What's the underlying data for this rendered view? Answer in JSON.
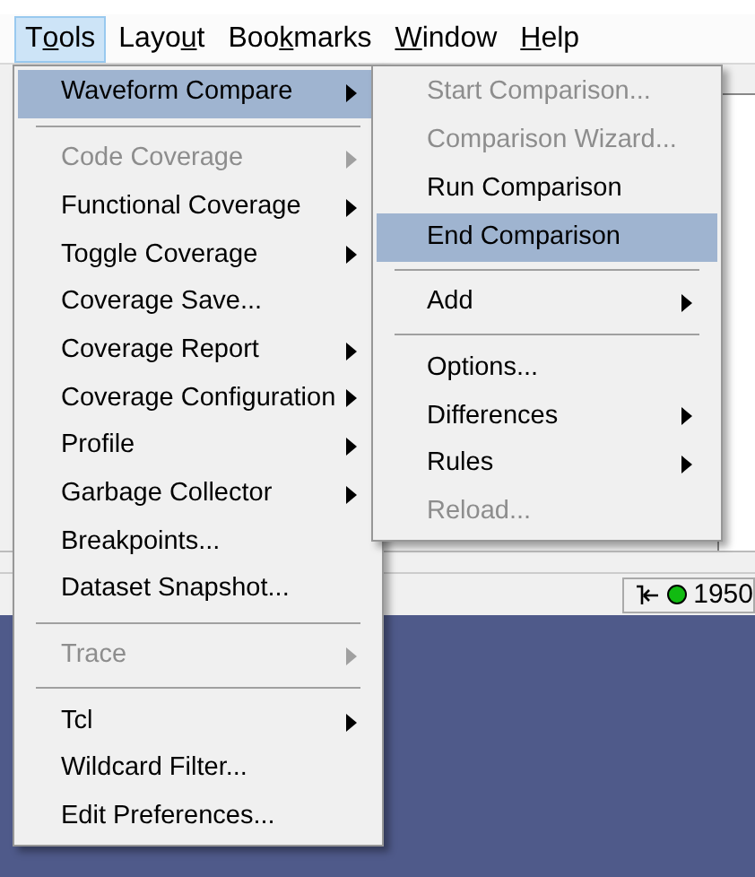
{
  "menu_bar": [
    {
      "before": "T",
      "mnemonic": "o",
      "after": "ols",
      "selected": true
    },
    {
      "before": "Layo",
      "mnemonic": "u",
      "after": "t",
      "selected": false
    },
    {
      "before": "Boo",
      "mnemonic": "k",
      "after": "marks",
      "selected": false
    },
    {
      "mnemonic": "W",
      "after": "indow",
      "selected": false
    },
    {
      "mnemonic": "H",
      "after": "elp",
      "selected": false
    }
  ],
  "tools_menu": [
    {
      "kind": "item",
      "label": "Waveform Compare",
      "submenu": true,
      "selected": true,
      "disabled": false
    },
    {
      "kind": "separator"
    },
    {
      "kind": "item",
      "label": "Code Coverage",
      "submenu": true,
      "selected": false,
      "disabled": true
    },
    {
      "kind": "item",
      "label": "Functional Coverage",
      "submenu": true,
      "selected": false,
      "disabled": false
    },
    {
      "kind": "item",
      "label": "Toggle Coverage",
      "submenu": true,
      "selected": false,
      "disabled": false
    },
    {
      "kind": "item",
      "label": "Coverage Save...",
      "submenu": false,
      "selected": false,
      "disabled": false
    },
    {
      "kind": "item",
      "label": "Coverage Report",
      "submenu": true,
      "selected": false,
      "disabled": false
    },
    {
      "kind": "item",
      "label": "Coverage Configuration",
      "submenu": true,
      "selected": false,
      "disabled": false
    },
    {
      "kind": "item",
      "label": "Profile",
      "submenu": true,
      "selected": false,
      "disabled": false
    },
    {
      "kind": "item",
      "label": "Garbage Collector",
      "submenu": true,
      "selected": false,
      "disabled": false
    },
    {
      "kind": "item",
      "label": "Breakpoints...",
      "submenu": false,
      "selected": false,
      "disabled": false
    },
    {
      "kind": "item",
      "label": "Dataset Snapshot...",
      "submenu": false,
      "selected": false,
      "disabled": false
    },
    {
      "kind": "separator"
    },
    {
      "kind": "item",
      "label": "Trace",
      "submenu": true,
      "selected": false,
      "disabled": true
    },
    {
      "kind": "separator"
    },
    {
      "kind": "item",
      "label": "Tcl",
      "submenu": true,
      "selected": false,
      "disabled": false
    },
    {
      "kind": "item",
      "label": "Wildcard Filter...",
      "submenu": false,
      "selected": false,
      "disabled": false
    },
    {
      "kind": "item",
      "label": "Edit Preferences...",
      "submenu": false,
      "selected": false,
      "disabled": false
    }
  ],
  "waveform_compare_submenu": [
    {
      "kind": "item",
      "label": "Start Comparison...",
      "submenu": false,
      "selected": false,
      "disabled": true
    },
    {
      "kind": "item",
      "label": "Comparison Wizard...",
      "submenu": false,
      "selected": false,
      "disabled": true
    },
    {
      "kind": "item",
      "label": "Run Comparison",
      "submenu": false,
      "selected": false,
      "disabled": false
    },
    {
      "kind": "item",
      "label": "End Comparison",
      "submenu": false,
      "selected": true,
      "disabled": false
    },
    {
      "kind": "separator"
    },
    {
      "kind": "item",
      "label": "Add",
      "submenu": true,
      "selected": false,
      "disabled": false
    },
    {
      "kind": "separator"
    },
    {
      "kind": "item",
      "label": "Options...",
      "submenu": false,
      "selected": false,
      "disabled": false
    },
    {
      "kind": "item",
      "label": "Differences",
      "submenu": true,
      "selected": false,
      "disabled": false
    },
    {
      "kind": "item",
      "label": "Rules",
      "submenu": true,
      "selected": false,
      "disabled": false
    },
    {
      "kind": "item",
      "label": "Reload...",
      "submenu": false,
      "selected": false,
      "disabled": true
    }
  ],
  "status_bar": {
    "indicator_on": true,
    "value": "1950"
  }
}
